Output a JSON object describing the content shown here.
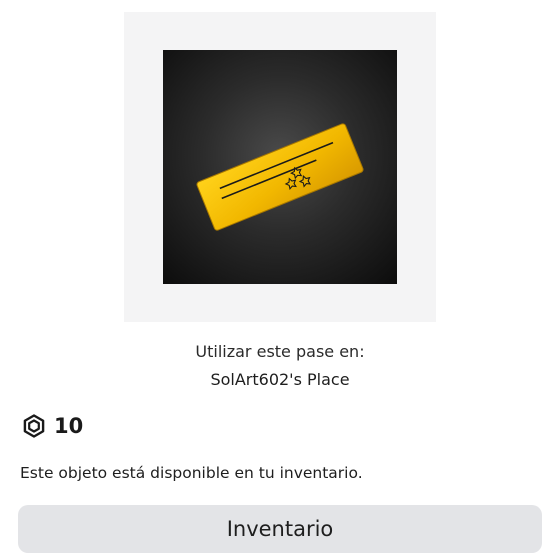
{
  "item": {
    "thumbnail_icon": "gold-ticket-icon",
    "use_label": "Utilizar este pase en:",
    "place_name": "SolArt602's Place"
  },
  "price": {
    "currency_icon": "robux-icon",
    "value": "10"
  },
  "availability_text": "Este objeto está disponible en tu inventario.",
  "inventory_button": {
    "label": "Inventario"
  },
  "colors": {
    "ticket_gold": "#f2c200",
    "button_bg": "#e3e4e7",
    "thumbnail_frame": "#f4f4f5"
  }
}
